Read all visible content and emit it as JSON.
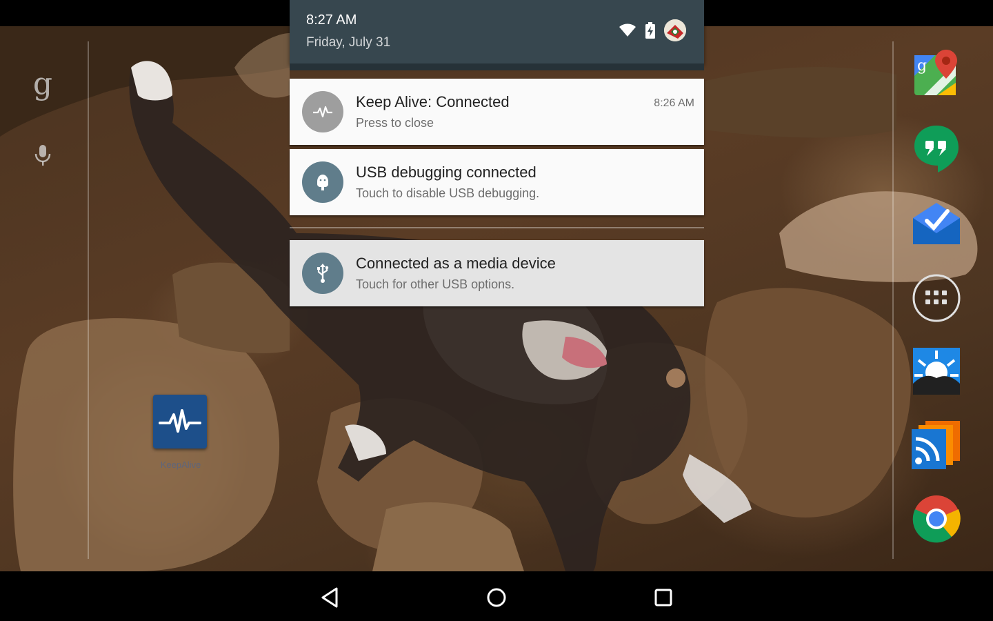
{
  "status": {
    "time": "8:27 AM",
    "date": "Friday, July 31"
  },
  "notifications": [
    {
      "title": "Keep Alive: Connected",
      "text": "Press to close",
      "time": "8:26 AM",
      "icon": "pulse-icon",
      "icon_color": "#9e9e9e"
    },
    {
      "title": "USB debugging connected",
      "text": "Touch to disable USB debugging.",
      "icon": "android-debug-icon",
      "icon_color": "#607d8b"
    },
    {
      "title": "Connected as a media device",
      "text": "Touch for other USB options.",
      "icon": "usb-icon",
      "icon_color": "#607d8b"
    }
  ],
  "desktop": {
    "shortcut_label": "KeepAlive",
    "shortcut_color": "#1d4f8a"
  },
  "dock": {
    "apps": [
      "maps-icon",
      "hangouts-icon",
      "inbox-icon",
      "app-drawer-icon",
      "photosphere-icon",
      "rss-icon",
      "chrome-icon"
    ]
  },
  "colors": {
    "shade_header": "#37474f",
    "accent_grey": "#607d8b"
  }
}
